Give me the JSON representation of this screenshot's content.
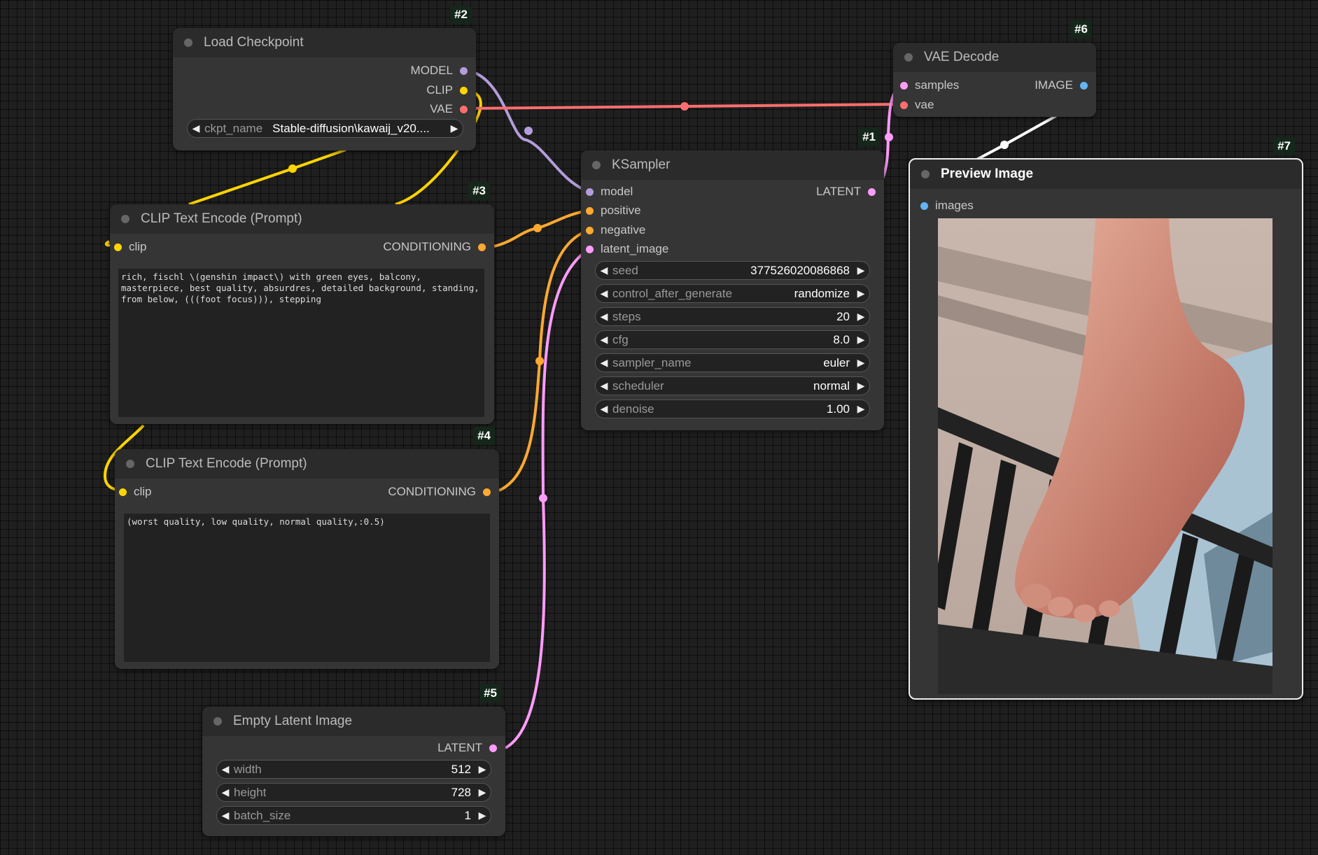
{
  "colors": {
    "model": "#b39ddb",
    "clip": "#ffd500",
    "vae": "#ff6e6e",
    "conditioning": "#ffa931",
    "latent": "#ff9cf9",
    "image": "#64b5f6"
  },
  "nodes": {
    "load_checkpoint": {
      "id": "#2",
      "title": "Load Checkpoint",
      "outputs": [
        "MODEL",
        "CLIP",
        "VAE"
      ],
      "ckpt_name_label": "ckpt_name",
      "ckpt_name_value": "Stable-diffusion\\kawaij_v20...."
    },
    "vae_decode": {
      "id": "#6",
      "title": "VAE Decode",
      "input_samples": "samples",
      "input_vae": "vae",
      "output_image": "IMAGE"
    },
    "ksampler": {
      "id": "#1",
      "title": "KSampler",
      "inputs": [
        "model",
        "positive",
        "negative",
        "latent_image"
      ],
      "output": "LATENT",
      "widgets": [
        {
          "name": "seed",
          "value": "377526020086868"
        },
        {
          "name": "control_after_generate",
          "value": "randomize"
        },
        {
          "name": "steps",
          "value": "20"
        },
        {
          "name": "cfg",
          "value": "8.0"
        },
        {
          "name": "sampler_name",
          "value": "euler"
        },
        {
          "name": "scheduler",
          "value": "normal"
        },
        {
          "name": "denoise",
          "value": "1.00"
        }
      ]
    },
    "preview_image": {
      "id": "#7",
      "title": "Preview Image",
      "input": "images"
    },
    "clip_pos": {
      "id": "#3",
      "title": "CLIP Text Encode (Prompt)",
      "input": "clip",
      "output": "CONDITIONING",
      "text": "rich, fischl \\(genshin impact\\) with green eyes, balcony,\nmasterpiece, best quality, absurdres, detailed background, standing,\nfrom below, (((foot focus))), stepping"
    },
    "clip_neg": {
      "id": "#4",
      "title": "CLIP Text Encode (Prompt)",
      "input": "clip",
      "output": "CONDITIONING",
      "text": "(worst quality, low quality, normal quality,:0.5)"
    },
    "empty_latent": {
      "id": "#5",
      "title": "Empty Latent Image",
      "output": "LATENT",
      "widgets": [
        {
          "name": "width",
          "value": "512"
        },
        {
          "name": "height",
          "value": "728"
        },
        {
          "name": "batch_size",
          "value": "1"
        }
      ]
    }
  }
}
